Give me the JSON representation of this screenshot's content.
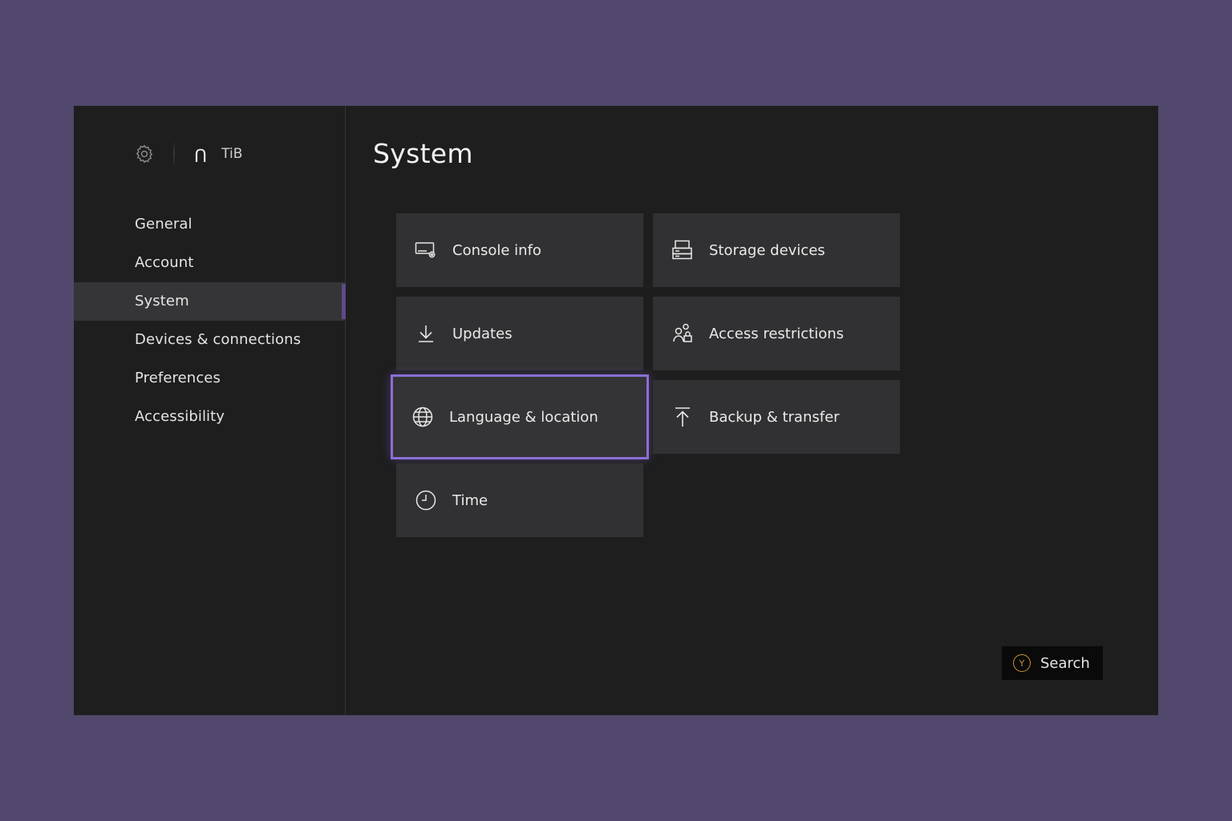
{
  "header": {
    "gamertag_glyph": "ꓵ",
    "gamertag": "TiB"
  },
  "sidebar": {
    "items": [
      {
        "label": "General"
      },
      {
        "label": "Account"
      },
      {
        "label": "System",
        "active": true
      },
      {
        "label": "Devices & connections"
      },
      {
        "label": "Preferences"
      },
      {
        "label": "Accessibility"
      }
    ]
  },
  "main": {
    "title": "System",
    "tiles": [
      {
        "label": "Console info",
        "icon": "console-info-icon"
      },
      {
        "label": "Storage devices",
        "icon": "storage-icon"
      },
      {
        "label": "Updates",
        "icon": "download-icon"
      },
      {
        "label": "Access restrictions",
        "icon": "people-lock-icon"
      },
      {
        "label": "Language & location",
        "icon": "globe-icon",
        "focused": true
      },
      {
        "label": "Backup & transfer",
        "icon": "upload-icon"
      },
      {
        "label": "Time",
        "icon": "clock-icon"
      }
    ]
  },
  "search": {
    "button_glyph": "Y",
    "label": "Search"
  },
  "colors": {
    "backdrop": "#52476c",
    "screen": "#1e1e1f",
    "tile": "#313133",
    "focus": "#8a6fd6",
    "y_button": "#c9913c"
  }
}
